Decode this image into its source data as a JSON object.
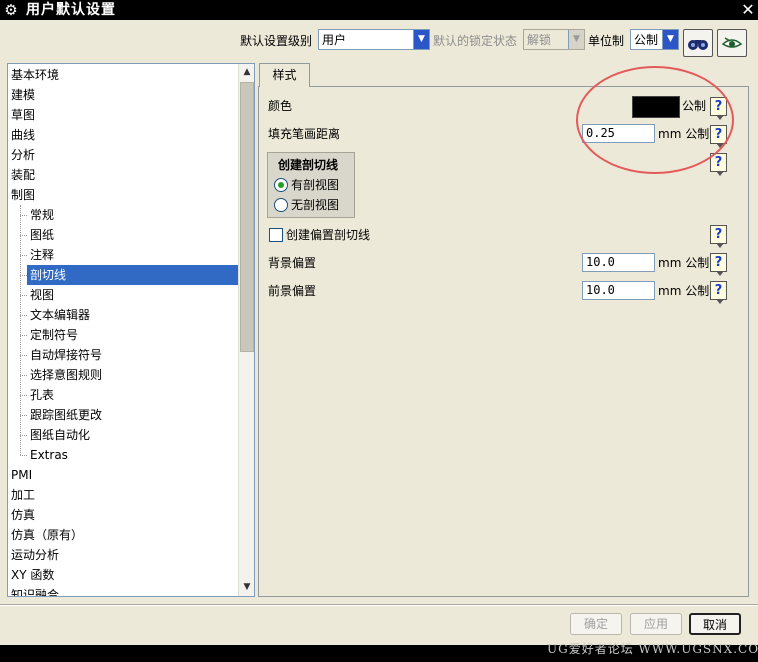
{
  "window": {
    "title": "用户默认设置",
    "close_glyph": "✕"
  },
  "top": {
    "level_label": "默认设置级别",
    "level_value": "用户",
    "lock_label": "默认的锁定状态",
    "lock_value": "解锁",
    "unit_label": "单位制",
    "unit_value": "公制",
    "tool_icons": [
      "binoculars-icon",
      "eye-icon"
    ]
  },
  "tree": {
    "items": [
      {
        "label": "基本环境",
        "level": 0
      },
      {
        "label": "建模",
        "level": 0
      },
      {
        "label": "草图",
        "level": 0
      },
      {
        "label": "曲线",
        "level": 0
      },
      {
        "label": "分析",
        "level": 0
      },
      {
        "label": "装配",
        "level": 0
      },
      {
        "label": "制图",
        "level": 0
      },
      {
        "label": "常规",
        "level": 1
      },
      {
        "label": "图纸",
        "level": 1
      },
      {
        "label": "注释",
        "level": 1
      },
      {
        "label": "剖切线",
        "level": 1,
        "selected": true
      },
      {
        "label": "视图",
        "level": 1
      },
      {
        "label": "文本编辑器",
        "level": 1
      },
      {
        "label": "定制符号",
        "level": 1
      },
      {
        "label": "自动焊接符号",
        "level": 1
      },
      {
        "label": "选择意图规则",
        "level": 1
      },
      {
        "label": "孔表",
        "level": 1
      },
      {
        "label": "跟踪图纸更改",
        "level": 1
      },
      {
        "label": "图纸自动化",
        "level": 1
      },
      {
        "label": "Extras",
        "level": 1
      },
      {
        "label": "PMI",
        "level": 0
      },
      {
        "label": "加工",
        "level": 0
      },
      {
        "label": "仿真",
        "level": 0
      },
      {
        "label": "仿真（原有）",
        "level": 0
      },
      {
        "label": "运动分析",
        "level": 0
      },
      {
        "label": "XY 函数",
        "level": 0
      },
      {
        "label": "知识融合",
        "level": 0
      }
    ]
  },
  "tabs": [
    {
      "label": "样式"
    }
  ],
  "settings": {
    "color_label": "颜色",
    "color_value": "#000000",
    "color_unit": "公制",
    "fill_label": "填充笔画距离",
    "fill_value": "0.25",
    "fill_unit": "mm 公制",
    "group_title": "创建剖切线",
    "radio_with": "有剖视图",
    "radio_without": "无剖视图",
    "radio_selected": "有剖视图",
    "offset_checkbox_label": "创建偏置剖切线",
    "offset_checked": false,
    "bg_label": "背景偏置",
    "bg_value": "10.0",
    "bg_unit": "mm 公制",
    "fg_label": "前景偏置",
    "fg_value": "10.0",
    "fg_unit": "mm 公制",
    "help_glyph": "?"
  },
  "buttons": {
    "ok": "确定",
    "apply": "应用",
    "cancel": "取消"
  },
  "watermark": "UG爱好者论坛 WWW.UGSNX.COM",
  "colors": {
    "selection": "#316ac5",
    "annotation": "#e45a5a",
    "help_q": "#1a3ec8",
    "radio_dot": "#21a121"
  }
}
